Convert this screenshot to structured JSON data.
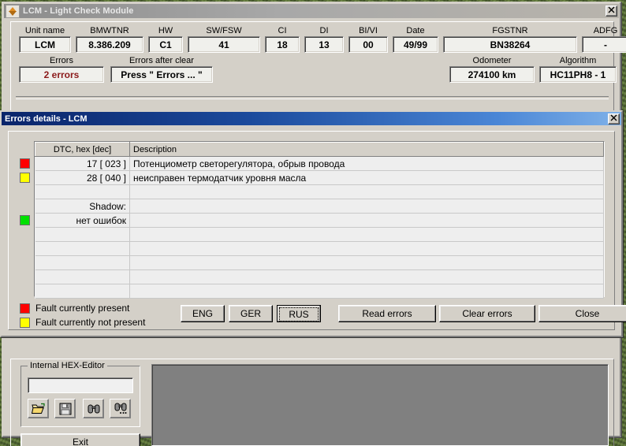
{
  "main_window": {
    "title": "LCM - Light Check Module",
    "app_icon": "bmw-lcm-icon",
    "close_label": "×"
  },
  "info_fields": [
    {
      "label": "Unit name",
      "value": "LCM"
    },
    {
      "label": "BMWTNR",
      "value": "8.386.209"
    },
    {
      "label": "HW",
      "value": "C1"
    },
    {
      "label": "SW/FSW",
      "value": "41"
    },
    {
      "label": "CI",
      "value": "18"
    },
    {
      "label": "DI",
      "value": "13"
    },
    {
      "label": "BI/VI",
      "value": "00"
    },
    {
      "label": "Date",
      "value": "49/99"
    },
    {
      "label": "FGSTNR",
      "value": "BN38264"
    },
    {
      "label": "ADFG",
      "value": "-"
    }
  ],
  "status_fields": {
    "errors_label": "Errors",
    "errors_value": "2 errors",
    "errors_value_color": "#8b1a1a",
    "errors_after_clear_label": "Errors after clear",
    "errors_after_clear_value": "Press \" Errors ... \"",
    "odometer_label": "Odometer",
    "odometer_value": "274100 km",
    "algorithm_label": "Algorithm",
    "algorithm_value": "HC11PH8 - 1"
  },
  "errors_dialog": {
    "title": "Errors details - LCM",
    "close_label": "×",
    "columns": [
      "DTC, hex [dec]",
      "Description"
    ],
    "rows": [
      {
        "status": "red",
        "dtc": "17 [ 023 ]",
        "description": "Потенциометр светорегулятора, обрыв провода"
      },
      {
        "status": "yellow",
        "dtc": "28 [ 040 ]",
        "description": "неисправен термодатчик уровня масла"
      },
      {
        "status": "",
        "dtc": "",
        "description": ""
      },
      {
        "status": "",
        "dtc": "Shadow:",
        "description": ""
      },
      {
        "status": "green",
        "dtc": "нет ошибок",
        "description": ""
      },
      {
        "status": "",
        "dtc": "",
        "description": ""
      },
      {
        "status": "",
        "dtc": "",
        "description": ""
      },
      {
        "status": "",
        "dtc": "",
        "description": ""
      },
      {
        "status": "",
        "dtc": "",
        "description": ""
      },
      {
        "status": "",
        "dtc": "",
        "description": ""
      }
    ],
    "legend": [
      {
        "color": "#ff0000",
        "text": "Fault currently present"
      },
      {
        "color": "#ffff00",
        "text": "Fault currently not present"
      }
    ],
    "buttons": {
      "eng": "ENG",
      "ger": "GER",
      "rus": "RUS",
      "read_errors": "Read errors",
      "clear_errors": "Clear errors",
      "close": "Close"
    },
    "focused_button": "RUS"
  },
  "hex_editor": {
    "group_label": "Internal HEX-Editor",
    "input_value": "",
    "input_placeholder": "",
    "tools": [
      {
        "name": "open-folder-icon",
        "glyph": "📂"
      },
      {
        "name": "save-disk-icon",
        "glyph": "💾"
      },
      {
        "name": "find-icon",
        "glyph": "\u0001"
      },
      {
        "name": "find-next-icon",
        "glyph": "\u0001"
      }
    ],
    "exit_label": "Exit"
  },
  "colors": {
    "window_face": "#d4d0c8",
    "title_active_start": "#0a246a",
    "title_active_end": "#7fb1e8",
    "title_inactive": "#a0a0a0",
    "grid_bg": "#eeeeee",
    "blank_panel": "#808080",
    "desktop": "#4e6132"
  }
}
